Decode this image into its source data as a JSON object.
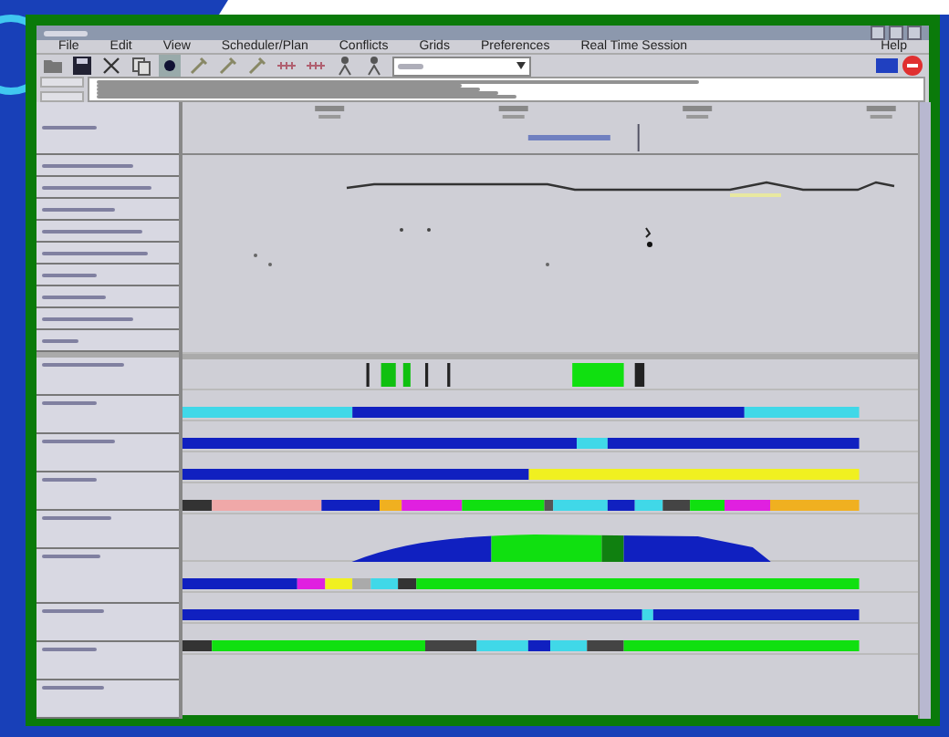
{
  "menu": [
    {
      "label": "File"
    },
    {
      "label": "Edit"
    },
    {
      "label": "View"
    },
    {
      "label": "Scheduler/Plan"
    },
    {
      "label": "Conflicts"
    },
    {
      "label": "Grids"
    },
    {
      "label": "Preferences"
    },
    {
      "label": "Real Time Session"
    }
  ],
  "help_menu": {
    "label": "Help"
  },
  "tracks": [
    {
      "kind": "marks",
      "segments": [
        {
          "color": "#222222"
        },
        {
          "color": "#10c010"
        },
        {
          "color": "#10c010"
        },
        {
          "color": "#222222"
        },
        {
          "color": "#222222"
        },
        {
          "color": "#10e010"
        },
        {
          "color": "#222222"
        }
      ]
    },
    {
      "kind": "bar",
      "segments": [
        {
          "color": "#40d8e8"
        },
        {
          "color": "#1020c0"
        },
        {
          "color": "#40d8e8"
        }
      ]
    },
    {
      "kind": "bar",
      "segments": [
        {
          "color": "#1020c0"
        },
        {
          "color": "#40d8e8"
        },
        {
          "color": "#1020c0"
        }
      ]
    },
    {
      "kind": "bar",
      "segments": [
        {
          "color": "#1020c0"
        },
        {
          "color": "#f0f020"
        }
      ]
    },
    {
      "kind": "bar",
      "segments": [
        {
          "color": "#333333"
        },
        {
          "color": "#f0a8a8"
        },
        {
          "color": "#1020c0"
        },
        {
          "color": "#f0b020"
        },
        {
          "color": "#e020e0"
        },
        {
          "color": "#10e010"
        },
        {
          "color": "#555555"
        },
        {
          "color": "#40d8e8"
        },
        {
          "color": "#1020c0"
        },
        {
          "color": "#40d8e8"
        },
        {
          "color": "#444444"
        },
        {
          "color": "#10e010"
        },
        {
          "color": "#e020e0"
        },
        {
          "color": "#f0b020"
        }
      ]
    },
    {
      "kind": "area",
      "segments": [
        {
          "color": "#1020c0"
        },
        {
          "color": "#10e010"
        },
        {
          "color": "#108010"
        },
        {
          "color": "#1020c0"
        }
      ]
    },
    {
      "kind": "bar",
      "segments": [
        {
          "color": "#1020c0"
        },
        {
          "color": "#e020e0"
        },
        {
          "color": "#f0f020"
        },
        {
          "color": "#aaaaaa"
        },
        {
          "color": "#40d8e8"
        },
        {
          "color": "#333333"
        },
        {
          "color": "#10e010"
        }
      ]
    },
    {
      "kind": "bar",
      "segments": [
        {
          "color": "#1020c0"
        },
        {
          "color": "#40d8e8"
        },
        {
          "color": "#1020c0"
        }
      ]
    },
    {
      "kind": "bar",
      "segments": [
        {
          "color": "#333333"
        },
        {
          "color": "#10e010"
        },
        {
          "color": "#444444"
        },
        {
          "color": "#40d8e8"
        },
        {
          "color": "#1020c0"
        },
        {
          "color": "#40d8e8"
        },
        {
          "color": "#444444"
        },
        {
          "color": "#10e010"
        }
      ]
    }
  ]
}
